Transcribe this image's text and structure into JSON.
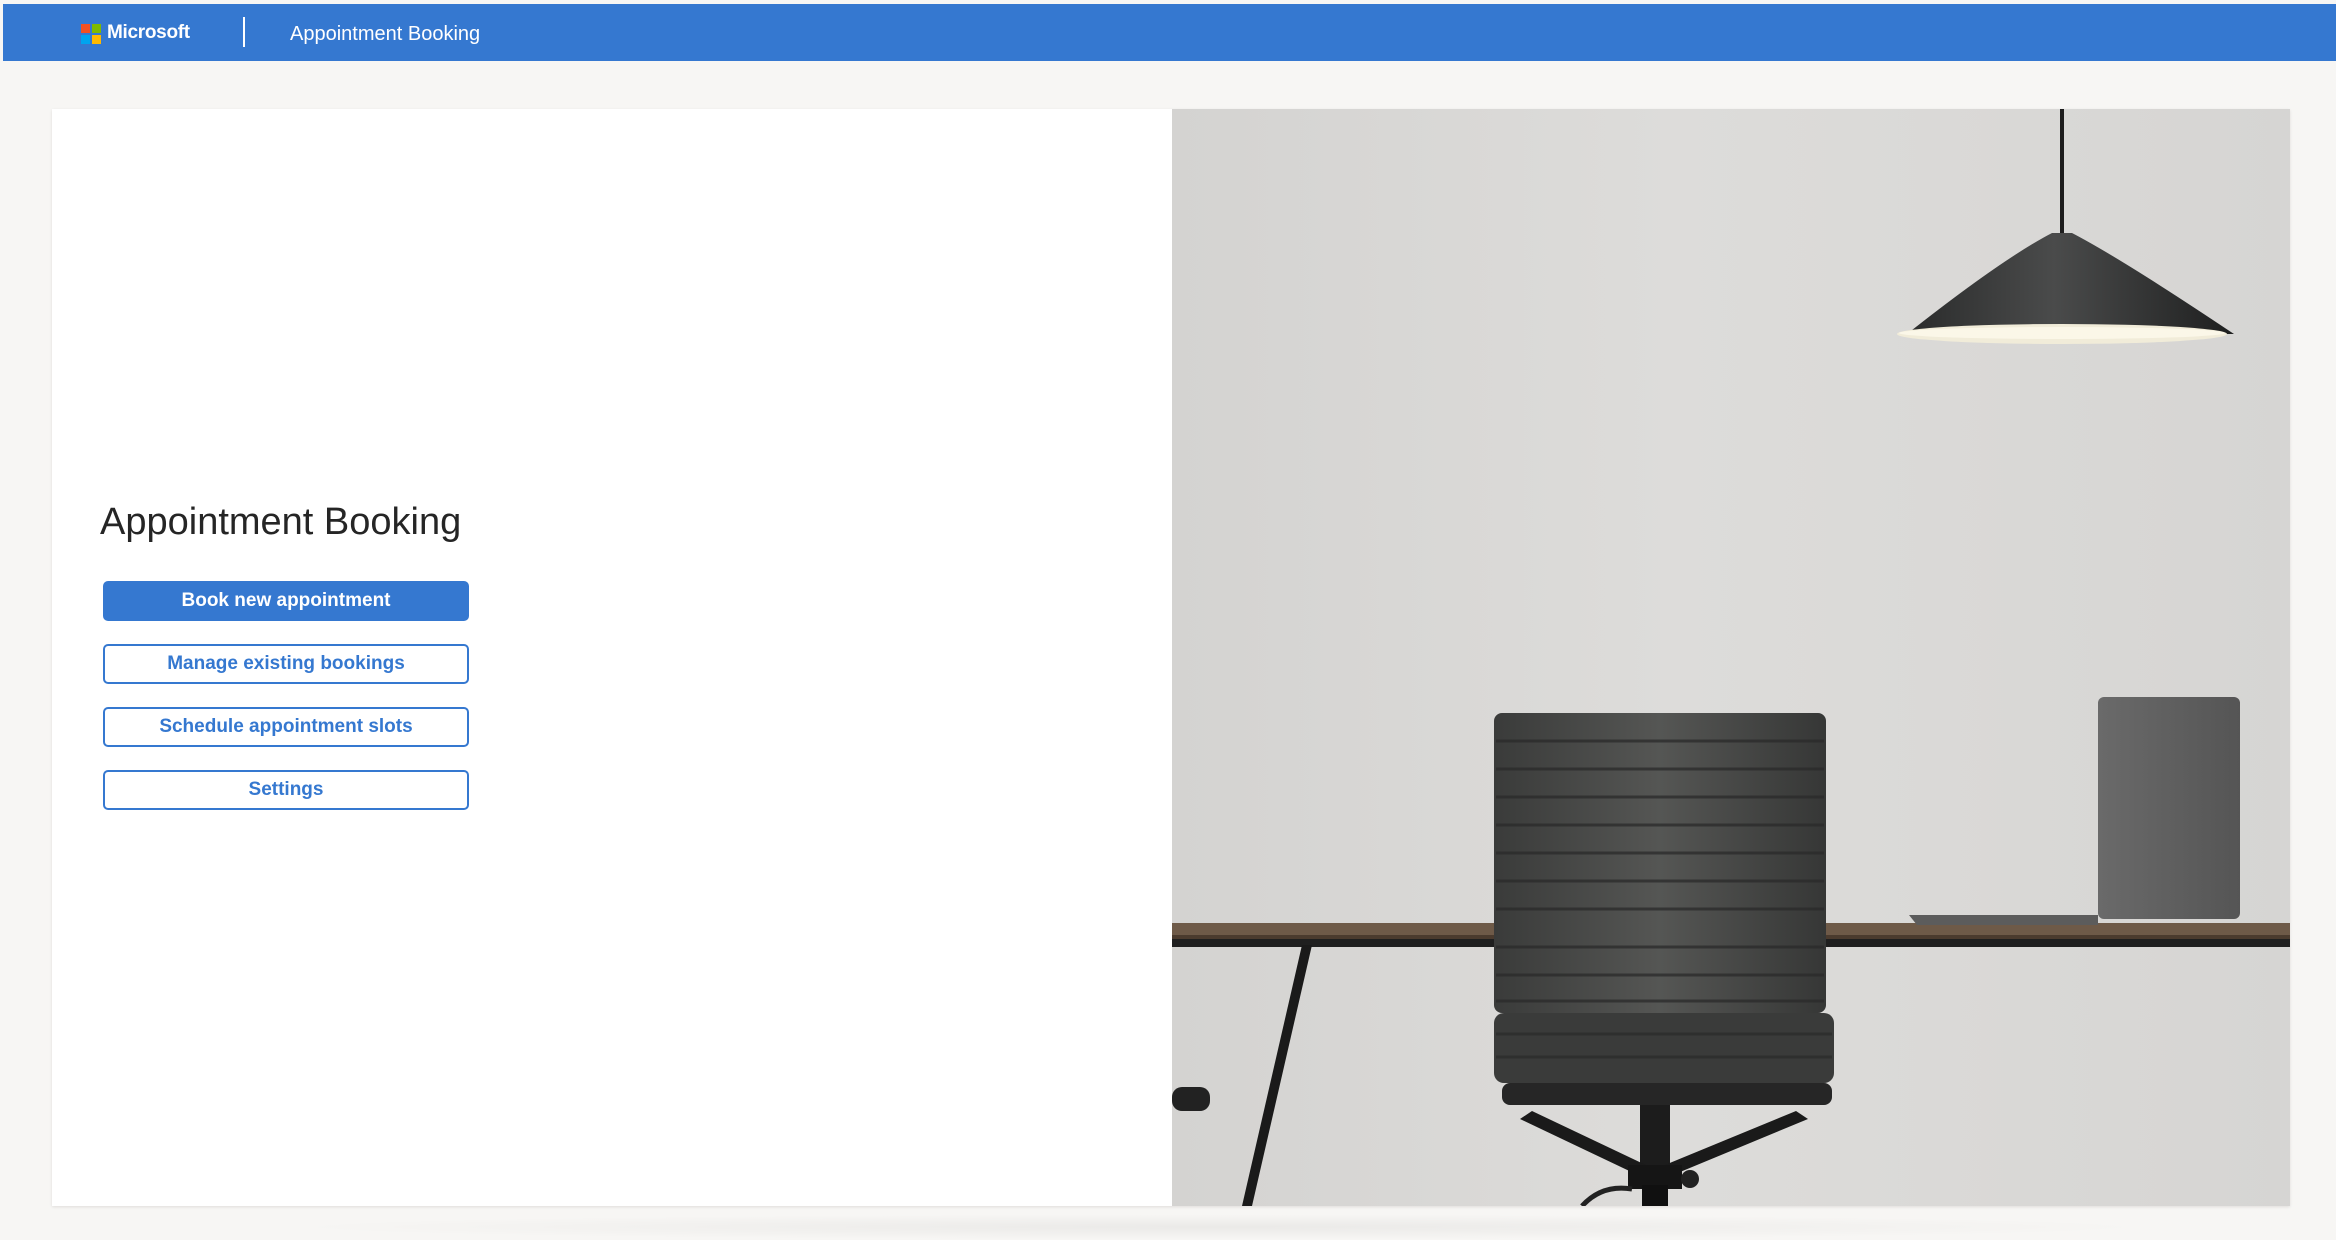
{
  "header": {
    "brand": "Microsoft",
    "app_title": "Appointment Booking"
  },
  "main": {
    "title": "Appointment Booking",
    "actions": [
      {
        "label": "Book new appointment",
        "style": "primary"
      },
      {
        "label": "Manage existing bookings",
        "style": "secondary"
      },
      {
        "label": "Schedule appointment slots",
        "style": "secondary"
      },
      {
        "label": "Settings",
        "style": "secondary"
      }
    ]
  },
  "hero_image": {
    "subject": "office-desk-chair-lamp-photo"
  },
  "colors": {
    "accent": "#3578d0",
    "page_background": "#f7f6f4",
    "card_background": "#ffffff",
    "title_text": "#252525"
  },
  "icons": {
    "brand_logo": "microsoft-logo-icon"
  }
}
